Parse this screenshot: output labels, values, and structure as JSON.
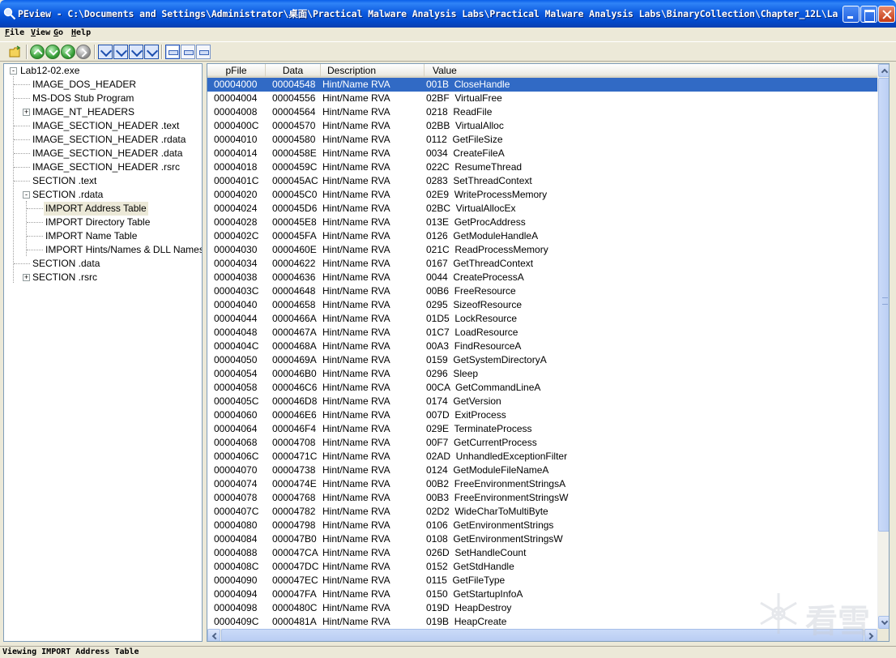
{
  "window": {
    "title": "PEview - C:\\Documents and Settings\\Administrator\\桌面\\Practical Malware Analysis Labs\\Practical Malware Analysis Labs\\BinaryCollection\\Chapter_12L\\La...",
    "accent": "#0a5fe8"
  },
  "menu": [
    "File",
    "View",
    "Go",
    "Help"
  ],
  "toolbar": {
    "icons": [
      "open-file-icon",
      "back-icon",
      "forward-icon",
      "previous-icon",
      "next-icon",
      "previous-item-icon",
      "next-item-icon",
      "first-icon",
      "last-icon",
      "view-hex-icon",
      "view-byte-icon",
      "view-word-icon"
    ]
  },
  "tree": [
    {
      "label": "Lab12-02.exe",
      "level": 0,
      "expander": "-"
    },
    {
      "label": "IMAGE_DOS_HEADER",
      "level": 1,
      "expander": ""
    },
    {
      "label": "MS-DOS Stub Program",
      "level": 1,
      "expander": ""
    },
    {
      "label": "IMAGE_NT_HEADERS",
      "level": 1,
      "expander": "+"
    },
    {
      "label": "IMAGE_SECTION_HEADER .text",
      "level": 1,
      "expander": ""
    },
    {
      "label": "IMAGE_SECTION_HEADER .rdata",
      "level": 1,
      "expander": ""
    },
    {
      "label": "IMAGE_SECTION_HEADER .data",
      "level": 1,
      "expander": ""
    },
    {
      "label": "IMAGE_SECTION_HEADER .rsrc",
      "level": 1,
      "expander": ""
    },
    {
      "label": "SECTION .text",
      "level": 1,
      "expander": ""
    },
    {
      "label": "SECTION .rdata",
      "level": 1,
      "expander": "-"
    },
    {
      "label": "IMPORT Address Table",
      "level": 2,
      "expander": "",
      "selected": true
    },
    {
      "label": "IMPORT Directory Table",
      "level": 2,
      "expander": ""
    },
    {
      "label": "IMPORT Name Table",
      "level": 2,
      "expander": ""
    },
    {
      "label": "IMPORT Hints/Names & DLL Names",
      "level": 2,
      "expander": ""
    },
    {
      "label": "SECTION .data",
      "level": 1,
      "expander": ""
    },
    {
      "label": "SECTION .rsrc",
      "level": 1,
      "expander": "+"
    }
  ],
  "list": {
    "columns": [
      "pFile",
      "Data",
      "Description",
      "Value"
    ],
    "selected_row": 0,
    "rows": [
      [
        "00004000",
        "00004548",
        "Hint/Name RVA",
        "001B  CloseHandle"
      ],
      [
        "00004004",
        "00004556",
        "Hint/Name RVA",
        "02BF  VirtualFree"
      ],
      [
        "00004008",
        "00004564",
        "Hint/Name RVA",
        "0218  ReadFile"
      ],
      [
        "0000400C",
        "00004570",
        "Hint/Name RVA",
        "02BB  VirtualAlloc"
      ],
      [
        "00004010",
        "00004580",
        "Hint/Name RVA",
        "0112  GetFileSize"
      ],
      [
        "00004014",
        "0000458E",
        "Hint/Name RVA",
        "0034  CreateFileA"
      ],
      [
        "00004018",
        "0000459C",
        "Hint/Name RVA",
        "022C  ResumeThread"
      ],
      [
        "0000401C",
        "000045AC",
        "Hint/Name RVA",
        "0283  SetThreadContext"
      ],
      [
        "00004020",
        "000045C0",
        "Hint/Name RVA",
        "02E9  WriteProcessMemory"
      ],
      [
        "00004024",
        "000045D6",
        "Hint/Name RVA",
        "02BC  VirtualAllocEx"
      ],
      [
        "00004028",
        "000045E8",
        "Hint/Name RVA",
        "013E  GetProcAddress"
      ],
      [
        "0000402C",
        "000045FA",
        "Hint/Name RVA",
        "0126  GetModuleHandleA"
      ],
      [
        "00004030",
        "0000460E",
        "Hint/Name RVA",
        "021C  ReadProcessMemory"
      ],
      [
        "00004034",
        "00004622",
        "Hint/Name RVA",
        "0167  GetThreadContext"
      ],
      [
        "00004038",
        "00004636",
        "Hint/Name RVA",
        "0044  CreateProcessA"
      ],
      [
        "0000403C",
        "00004648",
        "Hint/Name RVA",
        "00B6  FreeResource"
      ],
      [
        "00004040",
        "00004658",
        "Hint/Name RVA",
        "0295  SizeofResource"
      ],
      [
        "00004044",
        "0000466A",
        "Hint/Name RVA",
        "01D5  LockResource"
      ],
      [
        "00004048",
        "0000467A",
        "Hint/Name RVA",
        "01C7  LoadResource"
      ],
      [
        "0000404C",
        "0000468A",
        "Hint/Name RVA",
        "00A3  FindResourceA"
      ],
      [
        "00004050",
        "0000469A",
        "Hint/Name RVA",
        "0159  GetSystemDirectoryA"
      ],
      [
        "00004054",
        "000046B0",
        "Hint/Name RVA",
        "0296  Sleep"
      ],
      [
        "00004058",
        "000046C6",
        "Hint/Name RVA",
        "00CA  GetCommandLineA"
      ],
      [
        "0000405C",
        "000046D8",
        "Hint/Name RVA",
        "0174  GetVersion"
      ],
      [
        "00004060",
        "000046E6",
        "Hint/Name RVA",
        "007D  ExitProcess"
      ],
      [
        "00004064",
        "000046F4",
        "Hint/Name RVA",
        "029E  TerminateProcess"
      ],
      [
        "00004068",
        "00004708",
        "Hint/Name RVA",
        "00F7  GetCurrentProcess"
      ],
      [
        "0000406C",
        "0000471C",
        "Hint/Name RVA",
        "02AD  UnhandledExceptionFilter"
      ],
      [
        "00004070",
        "00004738",
        "Hint/Name RVA",
        "0124  GetModuleFileNameA"
      ],
      [
        "00004074",
        "0000474E",
        "Hint/Name RVA",
        "00B2  FreeEnvironmentStringsA"
      ],
      [
        "00004078",
        "00004768",
        "Hint/Name RVA",
        "00B3  FreeEnvironmentStringsW"
      ],
      [
        "0000407C",
        "00004782",
        "Hint/Name RVA",
        "02D2  WideCharToMultiByte"
      ],
      [
        "00004080",
        "00004798",
        "Hint/Name RVA",
        "0106  GetEnvironmentStrings"
      ],
      [
        "00004084",
        "000047B0",
        "Hint/Name RVA",
        "0108  GetEnvironmentStringsW"
      ],
      [
        "00004088",
        "000047CA",
        "Hint/Name RVA",
        "026D  SetHandleCount"
      ],
      [
        "0000408C",
        "000047DC",
        "Hint/Name RVA",
        "0152  GetStdHandle"
      ],
      [
        "00004090",
        "000047EC",
        "Hint/Name RVA",
        "0115  GetFileType"
      ],
      [
        "00004094",
        "000047FA",
        "Hint/Name RVA",
        "0150  GetStartupInfoA"
      ],
      [
        "00004098",
        "0000480C",
        "Hint/Name RVA",
        "019D  HeapDestroy"
      ],
      [
        "0000409C",
        "0000481A",
        "Hint/Name RVA",
        "019B  HeapCreate"
      ]
    ]
  },
  "status": "Viewing IMPORT Address Table",
  "watermark_text": "看雪",
  "colors": {
    "selection": "#316ac5",
    "tree_selection": "#ece9d8",
    "window_face": "#ece9d8"
  }
}
